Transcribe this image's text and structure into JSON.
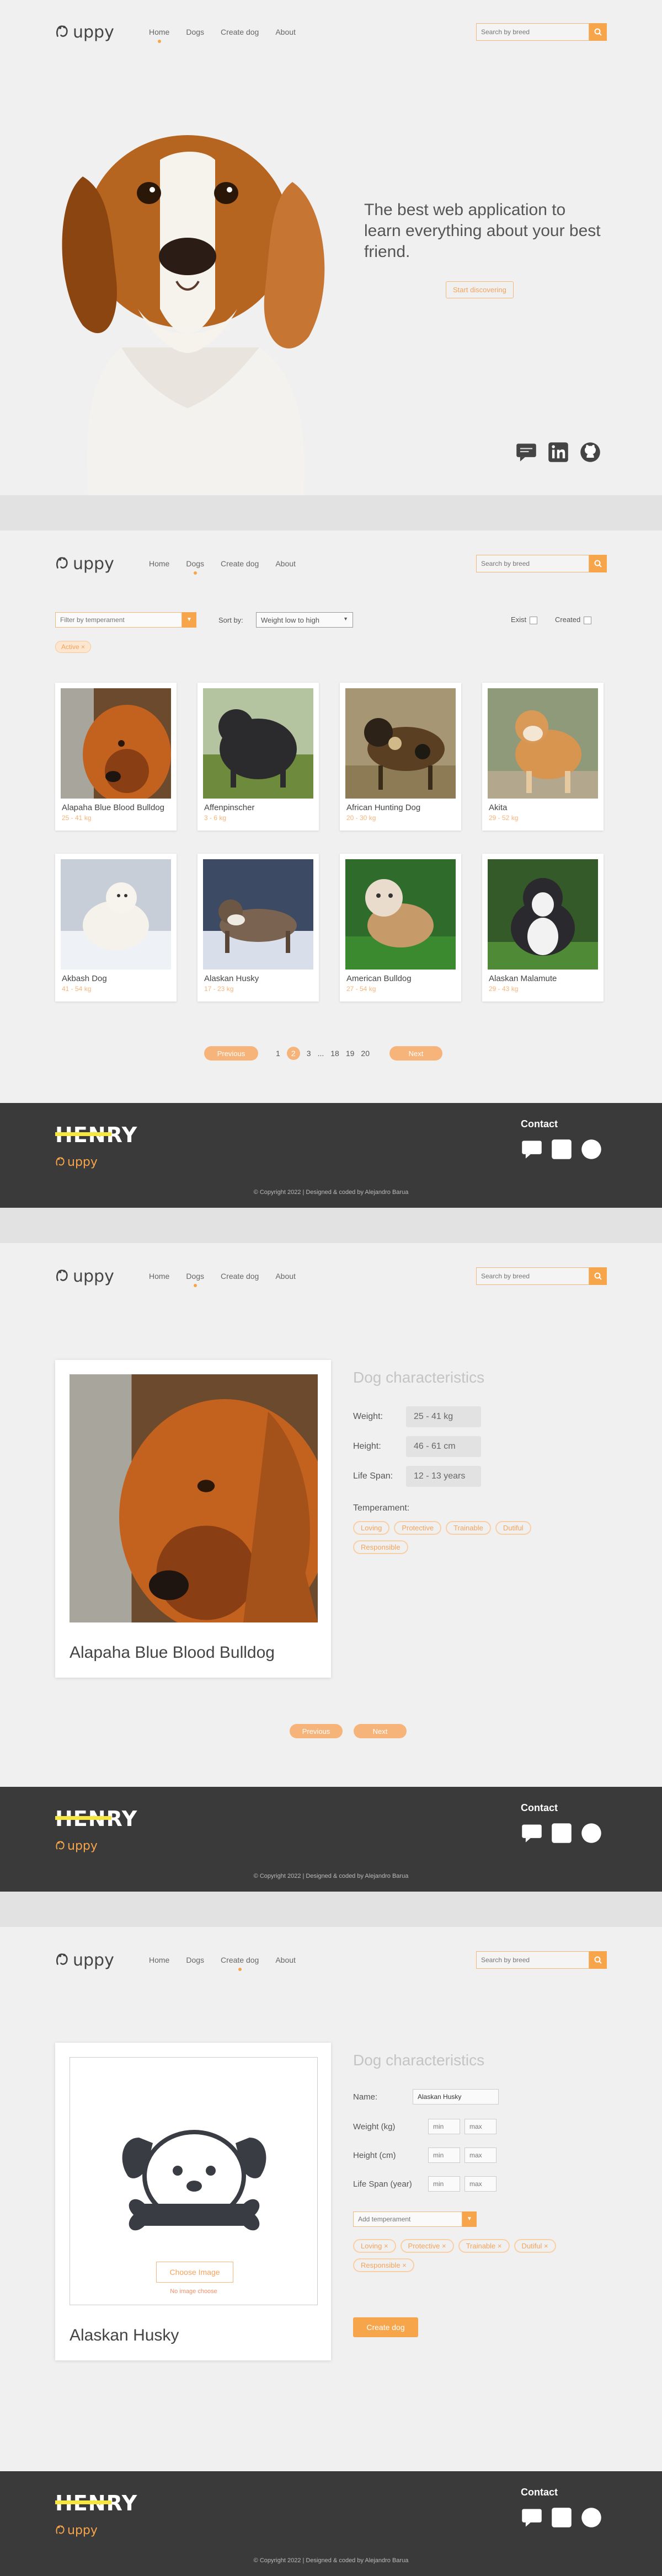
{
  "logo": {
    "text": "uppy"
  },
  "nav": {
    "home": "Home",
    "dogs": "Dogs",
    "create": "Create dog",
    "about": "About"
  },
  "search": {
    "placeholder": "Search by breed"
  },
  "hero": {
    "headline": "The best web application to learn everything about your best friend.",
    "cta": "Start discovering"
  },
  "filters": {
    "temperament_placeholder": "Filter by temperament",
    "sort_label": "Sort by:",
    "sort_value": "Weight low to high",
    "exist_label": "Exist",
    "created_label": "Created",
    "active_chip": "Active"
  },
  "dogs": [
    {
      "name": "Alapaha Blue Blood Bulldog",
      "weight": "25 - 41 kg"
    },
    {
      "name": "Affenpinscher",
      "weight": "3 - 6 kg"
    },
    {
      "name": "African Hunting Dog",
      "weight": "20 - 30 kg"
    },
    {
      "name": "Akita",
      "weight": "29 - 52 kg"
    },
    {
      "name": "Akbash Dog",
      "weight": "41 - 54 kg"
    },
    {
      "name": "Alaskan Husky",
      "weight": "17 - 23 kg"
    },
    {
      "name": "American Bulldog",
      "weight": "27 - 54 kg"
    },
    {
      "name": "Alaskan Malamute",
      "weight": "29 - 43 kg"
    }
  ],
  "pagination": {
    "prev": "Previous",
    "next": "Next",
    "p1": "1",
    "p2": "2",
    "p3": "3",
    "ellipsis": "...",
    "p18": "18",
    "p19": "19",
    "p20": "20"
  },
  "footer": {
    "brand": "HENRY",
    "logo_text": "uppy",
    "contact": "Contact",
    "copyright": "© Copyright 2022 | Designed & coded by Alejandro Barua"
  },
  "detail": {
    "title": "Dog characteristics",
    "dog_name": "Alapaha Blue Blood Bulldog",
    "weight_label": "Weight:",
    "weight_value": "25 - 41 kg",
    "height_label": "Height:",
    "height_value": "46 - 61 cm",
    "lifespan_label": "Life Span:",
    "lifespan_value": "12 - 13 years",
    "temperament_label": "Temperament:",
    "temperaments": [
      "Loving",
      "Protective",
      "Trainable",
      "Dutiful",
      "Responsible"
    ],
    "prev": "Previous",
    "next": "Next"
  },
  "create": {
    "title": "Dog characteristics",
    "name_label": "Name:",
    "name_value": "Alaskan Husky",
    "weight_label": "Weight (kg)",
    "height_label": "Height (cm)",
    "lifespan_label": "Life Span (year)",
    "min": "min",
    "max": "max",
    "temperament_placeholder": "Add temperament",
    "chips": [
      "Loving",
      "Protective",
      "Trainable",
      "Dutiful",
      "Responsible"
    ],
    "choose_image": "Choose Image",
    "no_image": "No image choose",
    "preview_name": "Alaskan Husky",
    "submit": "Create dog"
  },
  "colors": {
    "accent": "#f7a54a",
    "footer_bg": "#3a3a3a",
    "henry_yellow": "#f5e642"
  }
}
